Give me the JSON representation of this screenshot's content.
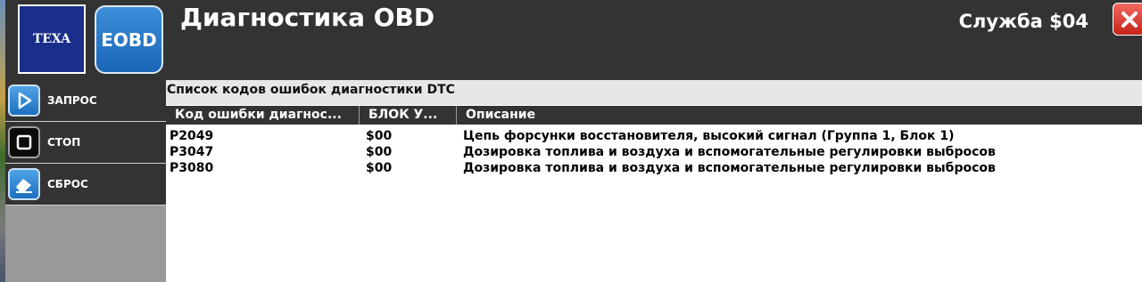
{
  "app": {
    "title": "Диагностика OBD",
    "service": "Служба $04",
    "logo_texa": "TEXA",
    "logo_eobd": "EOBD"
  },
  "sidebar": {
    "items": [
      {
        "label": "ЗАПРОС",
        "icon": "play-icon"
      },
      {
        "label": "СТОП",
        "icon": "stop-icon"
      },
      {
        "label": "СБРОС",
        "icon": "eraser-icon"
      }
    ]
  },
  "dtc": {
    "title": "Список кодов ошибок диагностики DTC",
    "columns": [
      "Код ошибки диагнос...",
      "БЛОК У...",
      "Описание"
    ],
    "rows": [
      {
        "code": "P2049",
        "block": "$00",
        "description": "Цепь форсунки восстановителя, высокий сигнал (Группа 1, Блок 1)"
      },
      {
        "code": "P3047",
        "block": "$00",
        "description": "Дозировка топлива и воздуха и вспомогательные регулировки выбросов"
      },
      {
        "code": "P3080",
        "block": "$00",
        "description": "Дозировка топлива и воздуха и вспомогательные регулировки выбросов"
      }
    ]
  },
  "colors": {
    "header_bg": "#333333",
    "sidebar_bg": "#999999",
    "list_title_bg": "#e7e7e7",
    "close_red": "#d8342b",
    "icon_blue": "#2a7fd0"
  }
}
